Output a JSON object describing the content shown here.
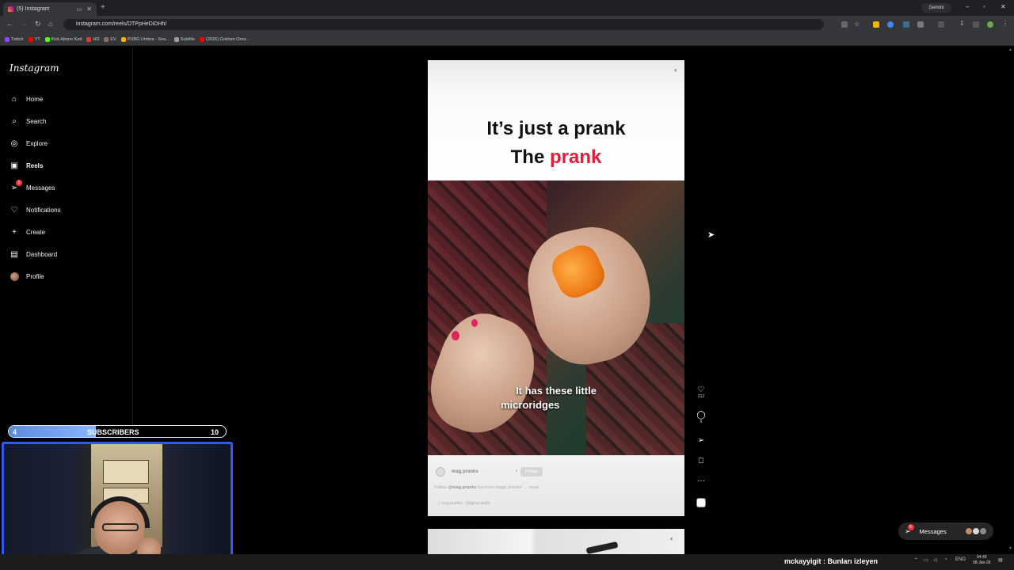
{
  "browser": {
    "tab_title": "(5) Instagram",
    "new_tab": "+",
    "url": "instagram.com/reels/DTPpHeDiDHh/",
    "gemini_label": "Gemini",
    "bookmarks": [
      {
        "label": "Twitch",
        "color": "#9146ff"
      },
      {
        "label": "YT",
        "color": "#ff0000"
      },
      {
        "label": "Kick Abone Kod",
        "color": "#53fc18"
      },
      {
        "label": "HD",
        "color": "#e53935"
      },
      {
        "label": "EV",
        "color": "#8d6e63"
      },
      {
        "label": "PUBG Umbra - Sea...",
        "color": "#f4b400"
      },
      {
        "label": "Subtitle",
        "color": "#9e9e9e"
      },
      {
        "label": "(2026) Gokhan Onnr...",
        "color": "#ff0000"
      }
    ]
  },
  "sidebar": {
    "logo": "Instagram",
    "items": [
      {
        "label": "Home",
        "icon": "home-icon",
        "glyph": "⌂"
      },
      {
        "label": "Search",
        "icon": "search-icon",
        "glyph": "⌕"
      },
      {
        "label": "Explore",
        "icon": "compass-icon",
        "glyph": "◎"
      },
      {
        "label": "Reels",
        "icon": "reels-icon",
        "glyph": "▣"
      },
      {
        "label": "Messages",
        "icon": "messages-icon",
        "glyph": "➢",
        "badge": "5"
      },
      {
        "label": "Notifications",
        "icon": "heart-icon",
        "glyph": "♡"
      },
      {
        "label": "Create",
        "icon": "plus-icon",
        "glyph": "+"
      },
      {
        "label": "Dashboard",
        "icon": "dashboard-icon",
        "glyph": "▤"
      },
      {
        "label": "Profile",
        "icon": "avatar-icon",
        "glyph": ""
      }
    ],
    "active": "Reels"
  },
  "reel": {
    "title_line1": "It’s just a prank",
    "title_line2_prefix": "The",
    "title_line2_highlight": "prank",
    "subtitle_line1": "It has these little",
    "subtitle_line2": "microridges",
    "username": "mag.pranks",
    "follow_label": "Follow",
    "separator": "•",
    "description_prefix": "Follow",
    "description_handle": "@mag.pranks",
    "description_rest": "for more magic pranks!",
    "description_more": "more",
    "audio_label": "mag.pranks · Original audio",
    "like_count": "212",
    "comment_count": "6"
  },
  "actions": {
    "like_icon": "heart-icon",
    "comment_icon": "comment-icon",
    "share_icon": "share-icon",
    "save_icon": "bookmark-icon",
    "more_icon": "more-icon",
    "more_glyph": "···"
  },
  "messages_pill": {
    "label": "Messages",
    "badge": "5"
  },
  "stream_overlay": {
    "sub_current": "4",
    "sub_label": "SUBSCRIBERS",
    "sub_goal": "10",
    "ticker": "mckayyigit : Bunları izleyen"
  },
  "taskbar": {
    "language": "ENG",
    "time": "04:40",
    "date": "08-Jan-26"
  },
  "colors": {
    "accent_red": "#e31e3a",
    "webcam_border": "#2f58ff",
    "sub_bar": "#8ab4ff"
  }
}
